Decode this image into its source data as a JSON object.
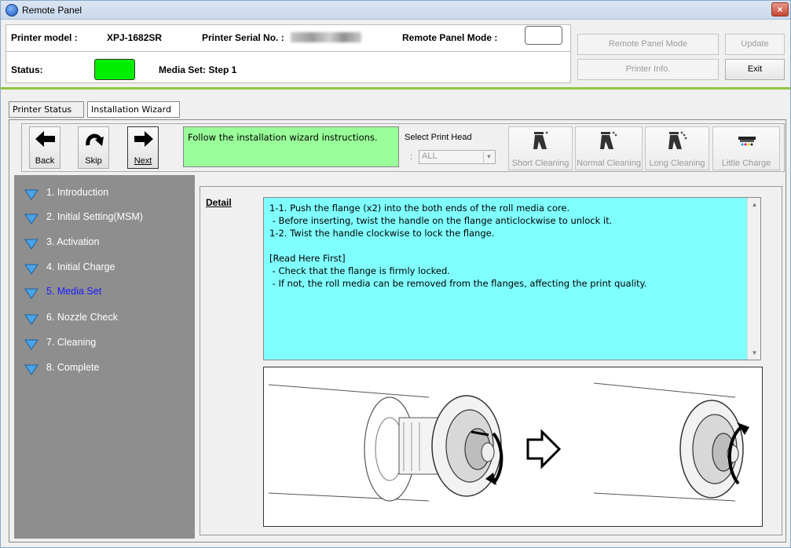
{
  "window": {
    "title": "Remote Panel",
    "close_glyph": "×"
  },
  "header": {
    "printer_model_label": "Printer model :",
    "printer_model_value": "XPJ-1682SR",
    "serial_label": "Printer Serial No. :",
    "remote_mode_label": "Remote Panel Mode :",
    "status_label": "Status:",
    "status_color": "#00ee00",
    "media_set_text": "Media Set: Step 1"
  },
  "buttons": {
    "remote_panel_mode": "Remote Panel Mode",
    "update": "Update",
    "printer_info": "Printer Info.",
    "exit": "Exit"
  },
  "tabs": [
    {
      "label": "Printer Status"
    },
    {
      "label": "Installation Wizard"
    }
  ],
  "toolbar": {
    "back": "Back",
    "skip": "Skip",
    "next": "Next",
    "instruction": "Follow the installation wizard instructions.",
    "select_print_head_label": "Select Print Head",
    "colon": ":",
    "select_print_head_value": "ALL",
    "short_cleaning": "Short Cleaning",
    "normal_cleaning": "Normal Cleaning",
    "long_cleaning": "Long Cleaning",
    "little_charge": "Little Charge"
  },
  "steps": [
    {
      "label": "1. Introduction"
    },
    {
      "label": "2. Initial Setting(MSM)"
    },
    {
      "label": "3. Activation"
    },
    {
      "label": "4. Initial Charge"
    },
    {
      "label": "5. Media Set"
    },
    {
      "label": "6. Nozzle Check"
    },
    {
      "label": "7. Cleaning"
    },
    {
      "label": "8. Complete"
    }
  ],
  "current_step": 5,
  "detail": {
    "label": "Detail",
    "lines": [
      "1-1. Push the flange (x2) into the both ends of the roll media core.",
      " - Before inserting, twist the handle on the flange anticlockwise to unlock it.",
      "1-2. Twist the handle clockwise to lock the flange.",
      "",
      "[Read Here First]",
      " - Check that the flange is firmly locked.",
      " - If not, the roll media can be removed from the flanges, affecting the print quality."
    ],
    "background_color": "#80ffff"
  },
  "colors": {
    "accent_line": "#8ec641",
    "instruction_bg": "#99ff99",
    "steps_bg": "#8e8e8e",
    "current_step_text": "#1a1aff"
  }
}
